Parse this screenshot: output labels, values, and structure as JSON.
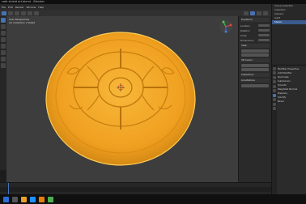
{
  "window": {
    "title": "cafe  shield art.blend - Blender"
  },
  "menu": {
    "items": [
      "File",
      "Edit",
      "Render",
      "Window",
      "Help"
    ]
  },
  "workspace_tabs": [
    "Layout",
    "Modeling",
    "Sculpting",
    "UV Editing",
    "Texture Paint",
    "Shading"
  ],
  "viewport": {
    "overlay_line1": "User Perspective",
    "overlay_line2": "(1) Collection | Shield",
    "object_color": "#f5a623",
    "background": "#3d3d3d"
  },
  "npanel": {
    "section_transform": "Transform",
    "rows": [
      "Location",
      "Rotation",
      "Scale",
      "Dimensions"
    ],
    "section_view": "View",
    "section_3dcursor": "3D Cursor",
    "section_collections": "Collections",
    "section_annotations": "Annotations"
  },
  "outliner": {
    "items": [
      "Scene Collection",
      "Collection",
      "Camera",
      "Light",
      "Shield"
    ]
  },
  "properties": {
    "items": [
      "Modifier Properties",
      "Add Modifier",
      "Decimate",
      "Subdivision",
      "Smooth",
      "Weighted Normal",
      "Displace",
      "Solidify",
      "Bevel"
    ]
  },
  "accent": "#4772b3"
}
